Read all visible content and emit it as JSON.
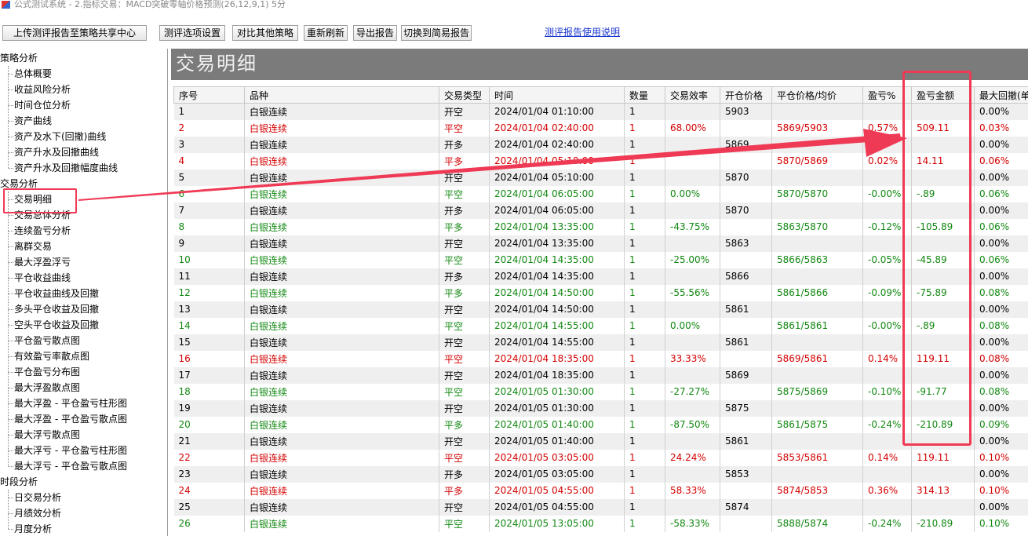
{
  "window": {
    "title": "公式测试系统 - 2.指标交易：MACD突破零轴价格预测(26,12,9,1) 5分"
  },
  "toolbar": {
    "upload_label": "上传测评报告至策略共享中心",
    "options_label": "测评选项设置",
    "compare_label": "对比其他策略",
    "refresh_label": "重新刷新",
    "export_label": "导出报告",
    "switch_label": "切换到简易报告",
    "help_label": "测评报告使用说明"
  },
  "sidebar": {
    "groups": [
      {
        "label": "策略分析",
        "items": [
          "总体概要",
          "收益风险分析",
          "时间仓位分析",
          "资产曲线",
          "资产及水下(回撤)曲线",
          "资产升水及回撤曲线",
          "资产升水及回撤幅度曲线"
        ]
      },
      {
        "label": "交易分析",
        "items": [
          "交易明细",
          "交易总体分析",
          "连续盈亏分析",
          "离群交易",
          "最大浮盈浮亏",
          "平仓收益曲线",
          "平仓收益曲线及回撤",
          "多头平仓收益及回撤",
          "空头平仓收益及回撤",
          "平仓盈亏散点图",
          "有效盈亏率散点图",
          "平仓盈亏分布图",
          "最大浮盈散点图",
          "最大浮盈 - 平仓盈亏柱形图",
          "最大浮盈 - 平仓盈亏散点图",
          "最大浮亏散点图",
          "最大浮亏 - 平仓盈亏柱形图",
          "最大浮亏 - 平仓盈亏散点图"
        ]
      },
      {
        "label": "时段分析",
        "items": [
          "日交易分析",
          "月绩效分析",
          "月度分析"
        ]
      }
    ]
  },
  "main": {
    "title": "交易明细",
    "columns": [
      "序号",
      "品种",
      "交易类型",
      "时间",
      "数量",
      "交易效率",
      "开仓价格",
      "平仓价格/均价",
      "盈亏%",
      "盈亏金额",
      "最大回撤(单"
    ],
    "rows": [
      [
        "1",
        "白银连续",
        "开空",
        "2024/01/04 01:10:00",
        "1",
        "",
        "5903",
        "",
        "",
        "",
        "0.00%"
      ],
      [
        "2",
        "白银连续",
        "平空",
        "2024/01/04 02:40:00",
        "1",
        "68.00%",
        "",
        "5869/5903",
        "0.57%",
        "509.11",
        "0.03%"
      ],
      [
        "3",
        "白银连续",
        "开多",
        "2024/01/04 02:40:00",
        "1",
        "",
        "5869",
        "",
        "",
        "",
        "0.00%"
      ],
      [
        "4",
        "白银连续",
        "平多",
        "2024/01/04 05:10:00",
        "1",
        "",
        "",
        "5870/5869",
        "0.02%",
        "14.11",
        "0.06%"
      ],
      [
        "5",
        "白银连续",
        "开空",
        "2024/01/04 05:10:00",
        "1",
        "",
        "5870",
        "",
        "",
        "",
        "0.00%"
      ],
      [
        "6",
        "白银连续",
        "平空",
        "2024/01/04 06:05:00",
        "1",
        "0.00%",
        "",
        "5870/5870",
        "-0.00%",
        "-.89",
        "0.06%"
      ],
      [
        "7",
        "白银连续",
        "开多",
        "2024/01/04 06:05:00",
        "1",
        "",
        "5870",
        "",
        "",
        "",
        "0.00%"
      ],
      [
        "8",
        "白银连续",
        "平多",
        "2024/01/04 13:35:00",
        "1",
        "-43.75%",
        "",
        "5863/5870",
        "-0.12%",
        "-105.89",
        "0.06%"
      ],
      [
        "9",
        "白银连续",
        "开空",
        "2024/01/04 13:35:00",
        "1",
        "",
        "5863",
        "",
        "",
        "",
        "0.00%"
      ],
      [
        "10",
        "白银连续",
        "平空",
        "2024/01/04 14:35:00",
        "1",
        "-25.00%",
        "",
        "5866/5863",
        "-0.05%",
        "-45.89",
        "0.06%"
      ],
      [
        "11",
        "白银连续",
        "开多",
        "2024/01/04 14:35:00",
        "1",
        "",
        "5866",
        "",
        "",
        "",
        "0.00%"
      ],
      [
        "12",
        "白银连续",
        "平多",
        "2024/01/04 14:50:00",
        "1",
        "-55.56%",
        "",
        "5861/5866",
        "-0.09%",
        "-75.89",
        "0.08%"
      ],
      [
        "13",
        "白银连续",
        "开空",
        "2024/01/04 14:50:00",
        "1",
        "",
        "5861",
        "",
        "",
        "",
        "0.00%"
      ],
      [
        "14",
        "白银连续",
        "平空",
        "2024/01/04 14:55:00",
        "1",
        "0.00%",
        "",
        "5861/5861",
        "-0.00%",
        "-.89",
        "0.08%"
      ],
      [
        "15",
        "白银连续",
        "开空",
        "2024/01/04 14:55:00",
        "1",
        "",
        "5861",
        "",
        "",
        "",
        "0.00%"
      ],
      [
        "16",
        "白银连续",
        "平空",
        "2024/01/04 18:35:00",
        "1",
        "33.33%",
        "",
        "5869/5861",
        "0.14%",
        "119.11",
        "0.08%"
      ],
      [
        "17",
        "白银连续",
        "开空",
        "2024/01/04 18:35:00",
        "1",
        "",
        "5869",
        "",
        "",
        "",
        "0.00%"
      ],
      [
        "18",
        "白银连续",
        "平空",
        "2024/01/05 01:30:00",
        "1",
        "-27.27%",
        "",
        "5875/5869",
        "-0.10%",
        "-91.77",
        "0.08%"
      ],
      [
        "19",
        "白银连续",
        "开空",
        "2024/01/05 01:30:00",
        "1",
        "",
        "5875",
        "",
        "",
        "",
        "0.00%"
      ],
      [
        "20",
        "白银连续",
        "平多",
        "2024/01/05 01:40:00",
        "1",
        "-87.50%",
        "",
        "5861/5875",
        "-0.24%",
        "-210.89",
        "0.09%"
      ],
      [
        "21",
        "白银连续",
        "开空",
        "2024/01/05 01:40:00",
        "1",
        "",
        "5861",
        "",
        "",
        "",
        "0.00%"
      ],
      [
        "22",
        "白银连续",
        "平空",
        "2024/01/05 03:05:00",
        "1",
        "24.24%",
        "",
        "5853/5861",
        "0.14%",
        "119.11",
        "0.10%"
      ],
      [
        "23",
        "白银连续",
        "开多",
        "2024/01/05 03:05:00",
        "1",
        "",
        "5853",
        "",
        "",
        "",
        "0.00%"
      ],
      [
        "24",
        "白银连续",
        "平多",
        "2024/01/05 04:55:00",
        "1",
        "58.33%",
        "",
        "5874/5853",
        "0.36%",
        "314.13",
        "0.10%"
      ],
      [
        "25",
        "白银连续",
        "开空",
        "2024/01/05 04:55:00",
        "1",
        "",
        "5874",
        "",
        "",
        "",
        "0.00%"
      ],
      [
        "26",
        "白银连续",
        "平空",
        "2024/01/05 13:05:00",
        "1",
        "-58.33%",
        "",
        "5888/5874",
        "-0.24%",
        "-210.89",
        "0.10%"
      ]
    ]
  },
  "colors": {
    "profit": "#d40000",
    "loss": "#118811",
    "highlight": "#ef3a55",
    "header_band": "#7b7b7b"
  }
}
